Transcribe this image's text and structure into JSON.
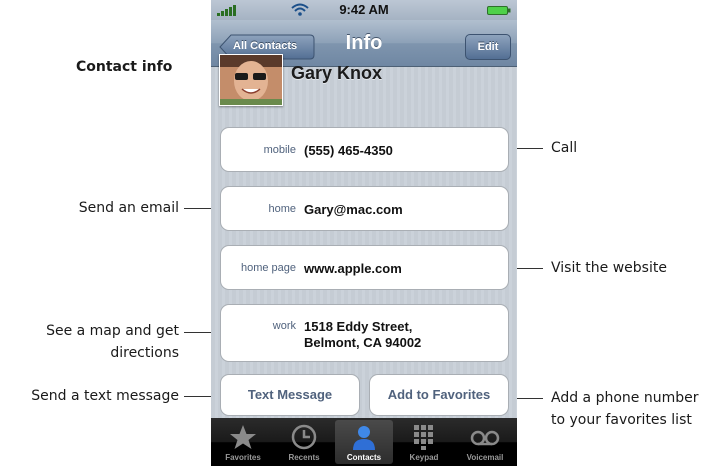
{
  "callouts": {
    "contact_info": "Contact info",
    "call": "Call",
    "send_email": "Send an email",
    "visit_website": "Visit the website",
    "map_line1": "See a map and get",
    "map_line2": "directions",
    "send_text": "Send a text message",
    "add_fav_line1": "Add a phone number",
    "add_fav_line2": "to your favorites list"
  },
  "status": {
    "time": "9:42 AM"
  },
  "nav": {
    "back_label": "All Contacts",
    "title": "Info",
    "edit_label": "Edit"
  },
  "contact": {
    "name": "Gary Knox"
  },
  "fields": [
    {
      "label": "mobile",
      "value": "(555) 465-4350"
    },
    {
      "label": "home",
      "value": "Gary@mac.com"
    },
    {
      "label": "home page",
      "value": "www.apple.com"
    },
    {
      "label": "work",
      "value_line1": "1518 Eddy Street,",
      "value_line2": "Belmont, CA 94002"
    }
  ],
  "actions": {
    "text_message": "Text Message",
    "add_favorites": "Add to Favorites"
  },
  "tabs": [
    {
      "label": "Favorites",
      "icon": "star-icon",
      "active": false
    },
    {
      "label": "Recents",
      "icon": "clock-icon",
      "active": false
    },
    {
      "label": "Contacts",
      "icon": "person-icon",
      "active": true
    },
    {
      "label": "Keypad",
      "icon": "keypad-icon",
      "active": false
    },
    {
      "label": "Voicemail",
      "icon": "voicemail-icon",
      "active": false
    }
  ],
  "colors": {
    "nav_bar": "#7f95ae",
    "field_label": "#50627d",
    "tab_active": "#2f6fd6"
  }
}
